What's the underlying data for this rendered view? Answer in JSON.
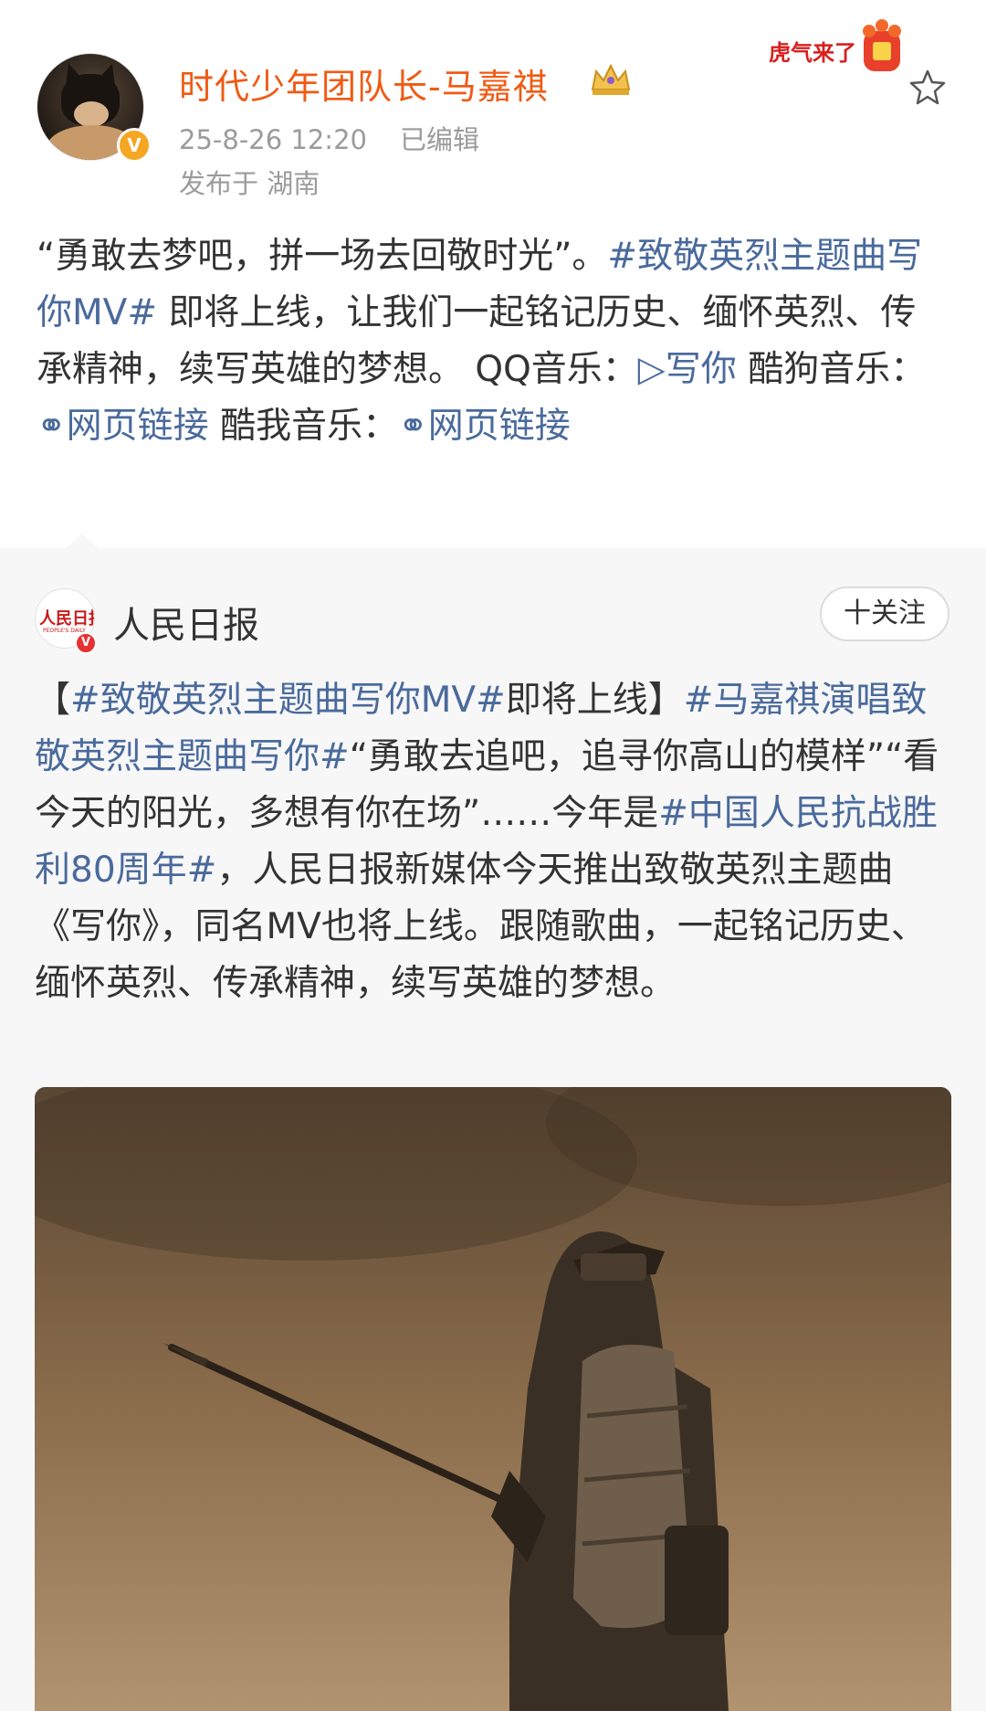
{
  "post": {
    "user_name": "时代少年团队长-马嘉祺",
    "timestamp": "25-8-26 12:20",
    "edited": "已编辑",
    "location": "发布于 湖南",
    "verified_mark": "V",
    "body": {
      "quote": "“勇敢去梦吧，拼一场去回敬时光”。",
      "topic": "#致敬英烈主题曲写你MV#",
      "text1": " 即将上线，让我们一起铭记历史、缅怀英烈、传承精神，续写英雄的梦想。 QQ音乐：",
      "link_qq": "▷写你",
      "text2": " 酷狗音乐：",
      "link_kugou": "⚭网页链接",
      "text3": " 酷我音乐：",
      "link_kuwo": "⚭网页链接"
    },
    "sticker_text": "虎气来了"
  },
  "repost": {
    "source_name": "人民日报",
    "source_logo": "人民日报",
    "source_logo_sub": "PEOPLE'S DAILY",
    "source_verified_mark": "V",
    "follow_label": "十关注",
    "body": {
      "part1": "【",
      "topic1": "#致敬英烈主题曲写你MV#",
      "part2": "即将上线】",
      "topic2": "#马嘉祺演唱致敬英烈主题曲写你#",
      "part3": "“勇敢去追吧，追寻你高山的模样”“看今天的阳光，多想有你在场”……今年是",
      "topic3": "#中国人民抗战胜利80周年#",
      "part4": "，人民日报新媒体今天推出致敬英烈主题曲《写你》，同名MV也将上线。跟随歌曲，一起铭记历史、缅怀英烈、传承精神，续写英雄的梦想。"
    }
  },
  "colors": {
    "username": "#f05a13",
    "link": "#4a6a9c",
    "meta": "#9b9b9b",
    "repost_bg": "#f7f7f7"
  },
  "icons": {
    "crown": "crown-icon",
    "star": "star-icon",
    "play": "play-icon",
    "link": "link-icon"
  }
}
